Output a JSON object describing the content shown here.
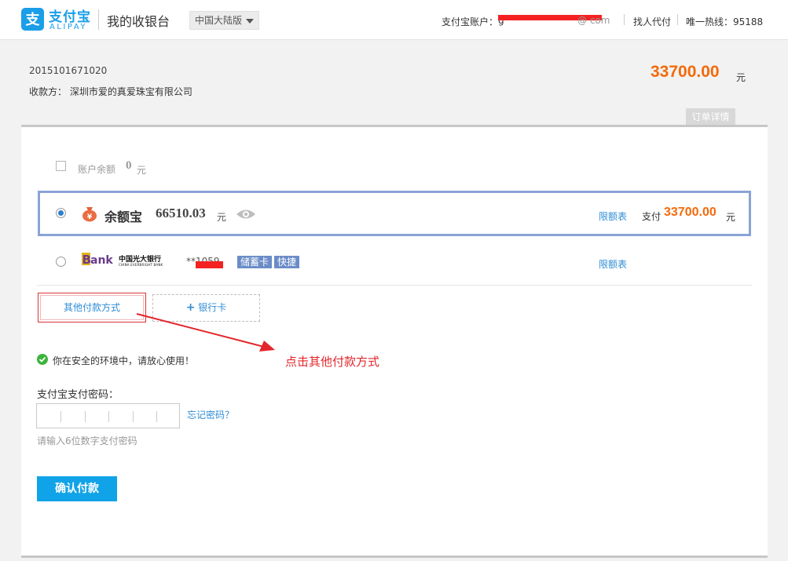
{
  "header": {
    "logo_cn": "支付宝",
    "logo_en": "ALIPAY",
    "title": "我的收银台",
    "region": "中国大陆版",
    "account_label": "支付宝账户：",
    "account_prefix": "g",
    "account_suffix": "@     com",
    "find_payer": "找人代付",
    "hotline": "唯一热线：95188"
  },
  "order": {
    "order_id": "2015101671020",
    "payee_label": "收款方：",
    "payee_name": "深圳市爱的真爱珠宝有限公司",
    "amount": "33700.00",
    "amount_unit": "元",
    "detail_tab": "订单详情"
  },
  "balance": {
    "label": "账户余额",
    "value": "0",
    "unit": "元"
  },
  "yuebao": {
    "name": "余额宝",
    "balance": "66510.03",
    "unit": "元",
    "limit_link": "限额表",
    "pay_label": "支付",
    "pay_amount": "33700.00",
    "pay_unit": "元"
  },
  "bank": {
    "name_cn": "中国光大银行",
    "name_en": "CHINA EVERBRIGHT BANK",
    "card_mask": "**1059",
    "tag_debit": "储蓄卡",
    "tag_quick": "快捷",
    "limit_link": "限额表"
  },
  "buttons": {
    "other_methods": "其他付款方式",
    "add_bank": "银行卡",
    "confirm": "确认付款"
  },
  "security": {
    "safe_message": "你在安全的环境中，请放心使用！",
    "password_label": "支付宝支付密码：",
    "forgot_link": "忘记密码？",
    "password_hint": "请输入6位数字支付密码"
  },
  "annotation": {
    "text": "点击其他付款方式"
  },
  "colors": {
    "brand_blue": "#1a9ee8",
    "amount_orange": "#f36a0a",
    "link_blue": "#2e8dd6",
    "annotation_red": "#e2262b",
    "confirm_blue": "#11a3e7"
  }
}
